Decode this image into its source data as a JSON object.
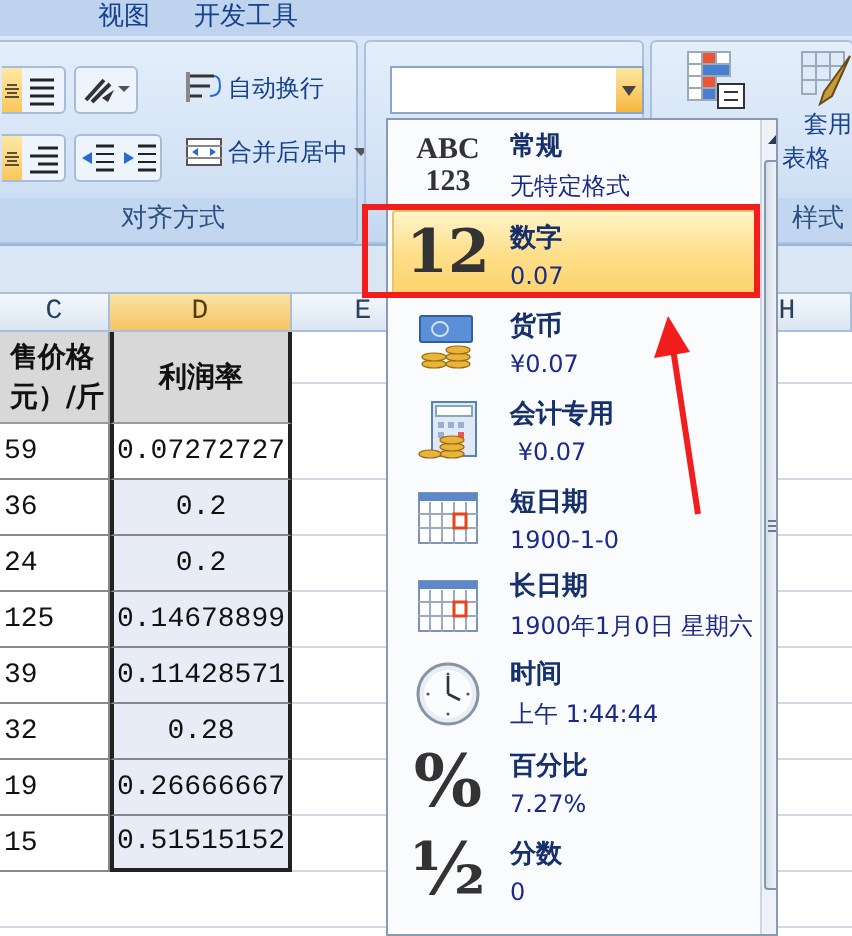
{
  "ribbon_tabs": [
    {
      "label": "视图"
    },
    {
      "label": "开发工具"
    }
  ],
  "alignment_group": {
    "align_rows": [
      [
        {
          "selected": true
        },
        {
          "selected": false
        }
      ],
      [
        {
          "selected": true
        },
        {
          "selected": false
        }
      ]
    ],
    "wrap_text": "自动换行",
    "merge_center": "合并后居中",
    "label": "对齐方式"
  },
  "styles_group": {
    "format_as_table": [
      "套用",
      "表格"
    ],
    "label": "样式"
  },
  "sheet": {
    "columns": [
      {
        "label": "C",
        "selected": false
      },
      {
        "label": "D",
        "selected": true
      },
      {
        "label": "E",
        "selected": false
      },
      {
        "label": "H",
        "selected": false
      }
    ],
    "header": [
      [
        "售价格",
        "元）/斤"
      ],
      [
        "利润率"
      ]
    ],
    "rows": [
      {
        "c": "59",
        "d": "0.07272727",
        "active": true
      },
      {
        "c": "36",
        "d": "0.2",
        "active": false
      },
      {
        "c": "24",
        "d": "0.2",
        "active": false
      },
      {
        "c": "125",
        "d": "0.14678899",
        "active": false
      },
      {
        "c": "39",
        "d": "0.11428571",
        "active": false
      },
      {
        "c": "32",
        "d": "0.28",
        "active": false
      },
      {
        "c": "19",
        "d": "0.26666667",
        "active": false
      },
      {
        "c": "15",
        "d": "0.51515152",
        "active": false
      }
    ]
  },
  "format_menu": {
    "items": [
      {
        "kind": "glyph",
        "glyph": "ABC\n123",
        "title": "常规",
        "sample": "无特定格式",
        "selected": false
      },
      {
        "kind": "glyph",
        "glyph": "12",
        "title": "数字",
        "sample": "0.07",
        "selected": true
      },
      {
        "kind": "currency",
        "title": "货币",
        "sample": "¥0.07",
        "selected": false
      },
      {
        "kind": "accounting",
        "title": "会计专用",
        "sample": " ¥0.07",
        "selected": false
      },
      {
        "kind": "calendar",
        "title": "短日期",
        "sample": "1900-1-0",
        "selected": false
      },
      {
        "kind": "calendar",
        "title": "长日期",
        "sample": "1900年1月0日 星期六",
        "selected": false
      },
      {
        "kind": "clock",
        "title": "时间",
        "sample": "上午 1:44:44",
        "selected": false
      },
      {
        "kind": "glyph",
        "glyph": "%",
        "title": "百分比",
        "sample": "7.27%",
        "selected": false
      },
      {
        "kind": "glyph",
        "glyph": "½",
        "title": "分数",
        "sample": "0",
        "selected": false
      }
    ]
  }
}
